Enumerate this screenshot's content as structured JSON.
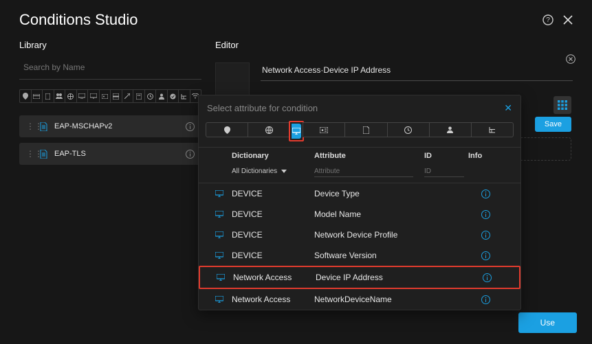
{
  "header": {
    "title": "Conditions Studio"
  },
  "library": {
    "label": "Library",
    "search_placeholder": "Search by Name",
    "items": [
      {
        "label": "EAP-MSCHAPv2"
      },
      {
        "label": "EAP-TLS"
      }
    ]
  },
  "editor": {
    "label": "Editor",
    "field_value": "Network Access·Device IP Address",
    "save_label": "Save",
    "use_label": "Use"
  },
  "picker": {
    "title": "Select attribute for condition",
    "columns": {
      "dictionary": "Dictionary",
      "attribute": "Attribute",
      "id": "ID",
      "info": "Info"
    },
    "filters": {
      "dictionary_label": "All Dictionaries",
      "attribute_placeholder": "Attribute",
      "id_placeholder": "ID"
    },
    "rows": [
      {
        "dictionary": "DEVICE",
        "attribute": "Device Type"
      },
      {
        "dictionary": "DEVICE",
        "attribute": "Model Name"
      },
      {
        "dictionary": "DEVICE",
        "attribute": "Network Device Profile"
      },
      {
        "dictionary": "DEVICE",
        "attribute": "Software Version"
      },
      {
        "dictionary": "Network Access",
        "attribute": "Device IP Address",
        "highlighted": true
      },
      {
        "dictionary": "Network Access",
        "attribute": "NetworkDeviceName"
      }
    ]
  }
}
